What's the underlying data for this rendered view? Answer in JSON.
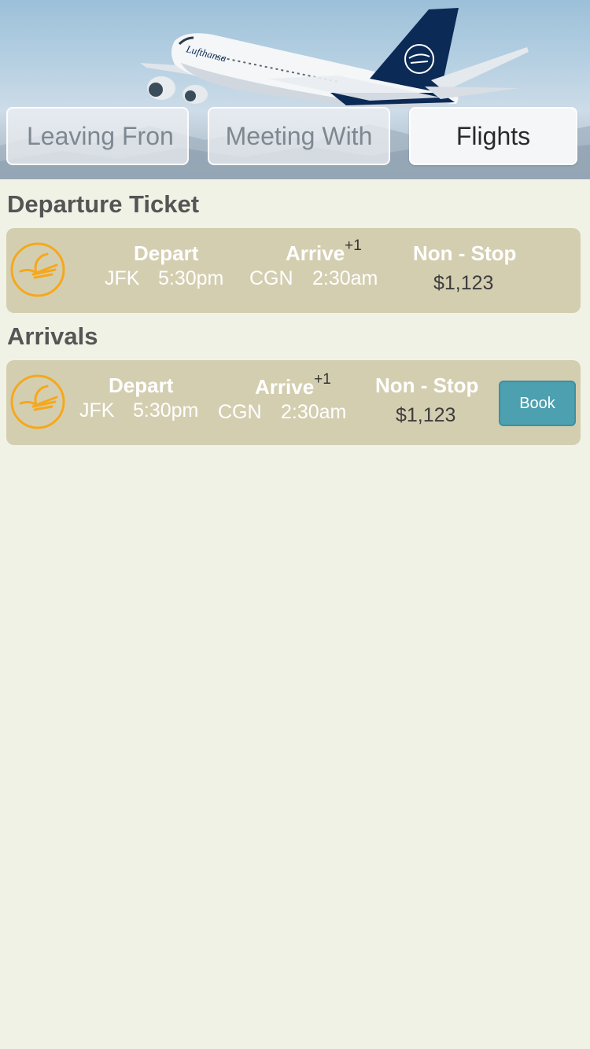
{
  "tabs": [
    {
      "label": "Leaving Fron",
      "state": "inactive"
    },
    {
      "label": "Meeting With",
      "state": "inactive"
    },
    {
      "label": "Flights",
      "state": "active"
    }
  ],
  "sections": {
    "departure_title": "Departure Ticket",
    "arrivals_title": "Arrivals"
  },
  "departure_flight": {
    "depart_label": "Depart",
    "arrive_label": "Arrive",
    "day_offset": "+1",
    "stops_label": "Non - Stop",
    "origin": "JFK",
    "depart_time": "5:30pm",
    "destination": "CGN",
    "arrive_time": "2:30am",
    "price": "$1,123",
    "airline_logo_icon": "crane-logo-icon"
  },
  "arrival_flight": {
    "depart_label": "Depart",
    "arrive_label": "Arrive",
    "day_offset": "+1",
    "stops_label": "Non - Stop",
    "origin": "JFK",
    "depart_time": "5:30pm",
    "destination": "CGN",
    "arrive_time": "2:30am",
    "price": "$1,123",
    "book_label": "Book",
    "airline_logo_icon": "crane-logo-icon"
  },
  "hero": {
    "airline_text": "Lufthansa"
  },
  "colors": {
    "background": "#f1f2e6",
    "card": "#d4ceb1",
    "logo": "#f5a81c",
    "book_button": "#4ca0b0",
    "heading": "#555555"
  }
}
